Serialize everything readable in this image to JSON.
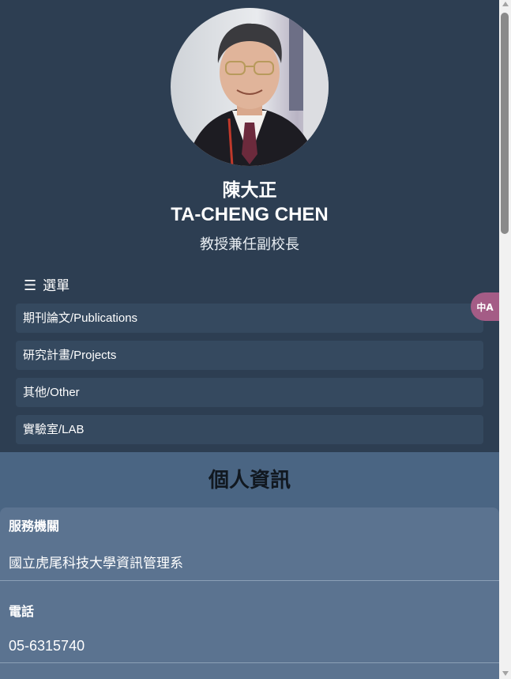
{
  "profile": {
    "name_zh": "陳大正",
    "name_en": "TA-CHENG CHEN",
    "title": "教授兼任副校長",
    "avatar_label": "profile-photo"
  },
  "menu": {
    "label": "選單",
    "hamburger_icon": "☰",
    "items": [
      {
        "label": "期刊論文/Publications"
      },
      {
        "label": "研究計畫/Projects"
      },
      {
        "label": "其他/Other"
      },
      {
        "label": "實驗室/LAB"
      }
    ]
  },
  "personal_info": {
    "heading": "個人資訊",
    "fields": [
      {
        "label": "服務機關",
        "value": "國立虎尾科技大學資訊管理系"
      },
      {
        "label": "電話",
        "value": "05-6315740"
      }
    ]
  },
  "translate_button": {
    "icon": "translate-icon",
    "glyph": "中A"
  },
  "colors": {
    "header_bg": "#2d3e52",
    "menu_item_bg": "#35495f",
    "info_section_bg": "#4a6583",
    "info_card_bg": "#5b7390",
    "translate_bg": "#a45c86"
  }
}
